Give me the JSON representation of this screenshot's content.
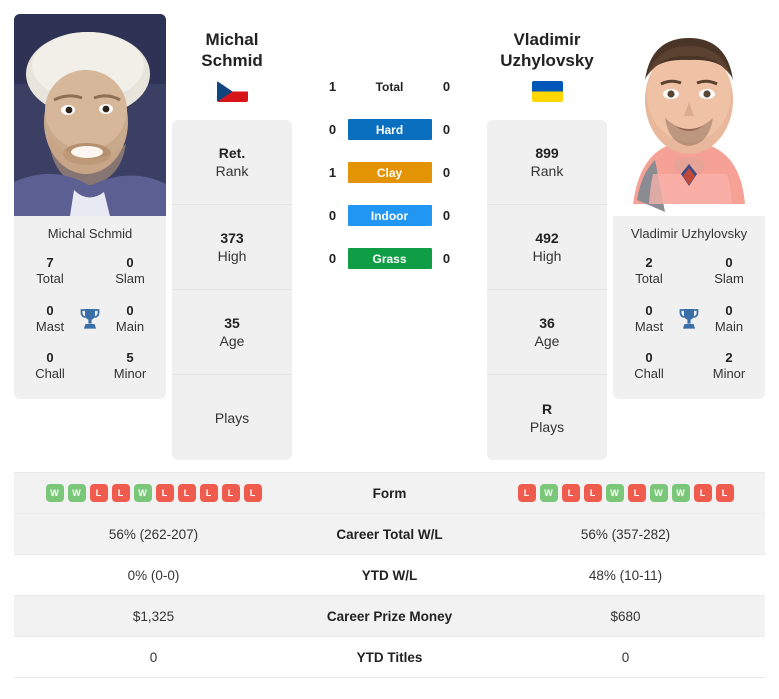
{
  "left_player": {
    "name_line1": "Michal",
    "name_line2": "Schmid",
    "full_name": "Michal Schmid",
    "caption": "Michal Schmid",
    "flag": "czech-republic-flag",
    "titles": {
      "total_value": "7",
      "total_label": "Total",
      "slam_value": "0",
      "slam_label": "Slam",
      "mast_value": "0",
      "mast_label": "Mast",
      "main_value": "0",
      "main_label": "Main",
      "chall_value": "0",
      "chall_label": "Chall",
      "minor_value": "5",
      "minor_label": "Minor"
    },
    "rank_card": [
      {
        "value": "Ret.",
        "label": "Rank"
      },
      {
        "value": "373",
        "label": "High"
      },
      {
        "value": "35",
        "label": "Age"
      },
      {
        "value": "",
        "label": "Plays"
      }
    ],
    "form": [
      "W",
      "W",
      "L",
      "L",
      "W",
      "L",
      "L",
      "L",
      "L",
      "L"
    ]
  },
  "right_player": {
    "name_line1": "Vladimir",
    "name_line2": "Uzhylovsky",
    "full_name": "Vladimir Uzhylovsky",
    "caption": "Vladimir Uzhylovsky",
    "flag": "ukraine-flag",
    "titles": {
      "total_value": "2",
      "total_label": "Total",
      "slam_value": "0",
      "slam_label": "Slam",
      "mast_value": "0",
      "mast_label": "Mast",
      "main_value": "0",
      "main_label": "Main",
      "chall_value": "0",
      "chall_label": "Chall",
      "minor_value": "2",
      "minor_label": "Minor"
    },
    "rank_card": [
      {
        "value": "899",
        "label": "Rank"
      },
      {
        "value": "492",
        "label": "High"
      },
      {
        "value": "36",
        "label": "Age"
      },
      {
        "value": "R",
        "label": "Plays"
      }
    ],
    "form": [
      "L",
      "W",
      "L",
      "L",
      "W",
      "L",
      "W",
      "W",
      "L",
      "L"
    ]
  },
  "head_to_head": [
    {
      "label": "Total",
      "left": "1",
      "right": "0",
      "color": "none",
      "style": "plain"
    },
    {
      "label": "Hard",
      "left": "0",
      "right": "0",
      "color": "#0b6fc0",
      "style": "badge"
    },
    {
      "label": "Clay",
      "left": "1",
      "right": "0",
      "color": "#e29404",
      "style": "badge"
    },
    {
      "label": "Indoor",
      "left": "0",
      "right": "0",
      "color": "#2196f3",
      "style": "badge"
    },
    {
      "label": "Grass",
      "left": "0",
      "right": "0",
      "color": "#0f9d45",
      "style": "badge"
    }
  ],
  "stats_rows": [
    {
      "label": "Form",
      "left": "",
      "right": "",
      "type": "form"
    },
    {
      "label": "Career Total W/L",
      "left": "56% (262-207)",
      "right": "56% (357-282)",
      "type": "text"
    },
    {
      "label": "YTD W/L",
      "left": "0% (0-0)",
      "right": "48% (10-11)",
      "type": "text"
    },
    {
      "label": "Career Prize Money",
      "left": "$1,325",
      "right": "$680",
      "type": "text"
    },
    {
      "label": "YTD Titles",
      "left": "0",
      "right": "0",
      "type": "text"
    }
  ],
  "colors": {
    "win_badge": "#7ac77a",
    "loss_badge": "#ef5b4c",
    "card_bg": "#f0f0f0",
    "row_alt_bg": "#f2f2f2",
    "trophy": "#3a6ea8"
  }
}
